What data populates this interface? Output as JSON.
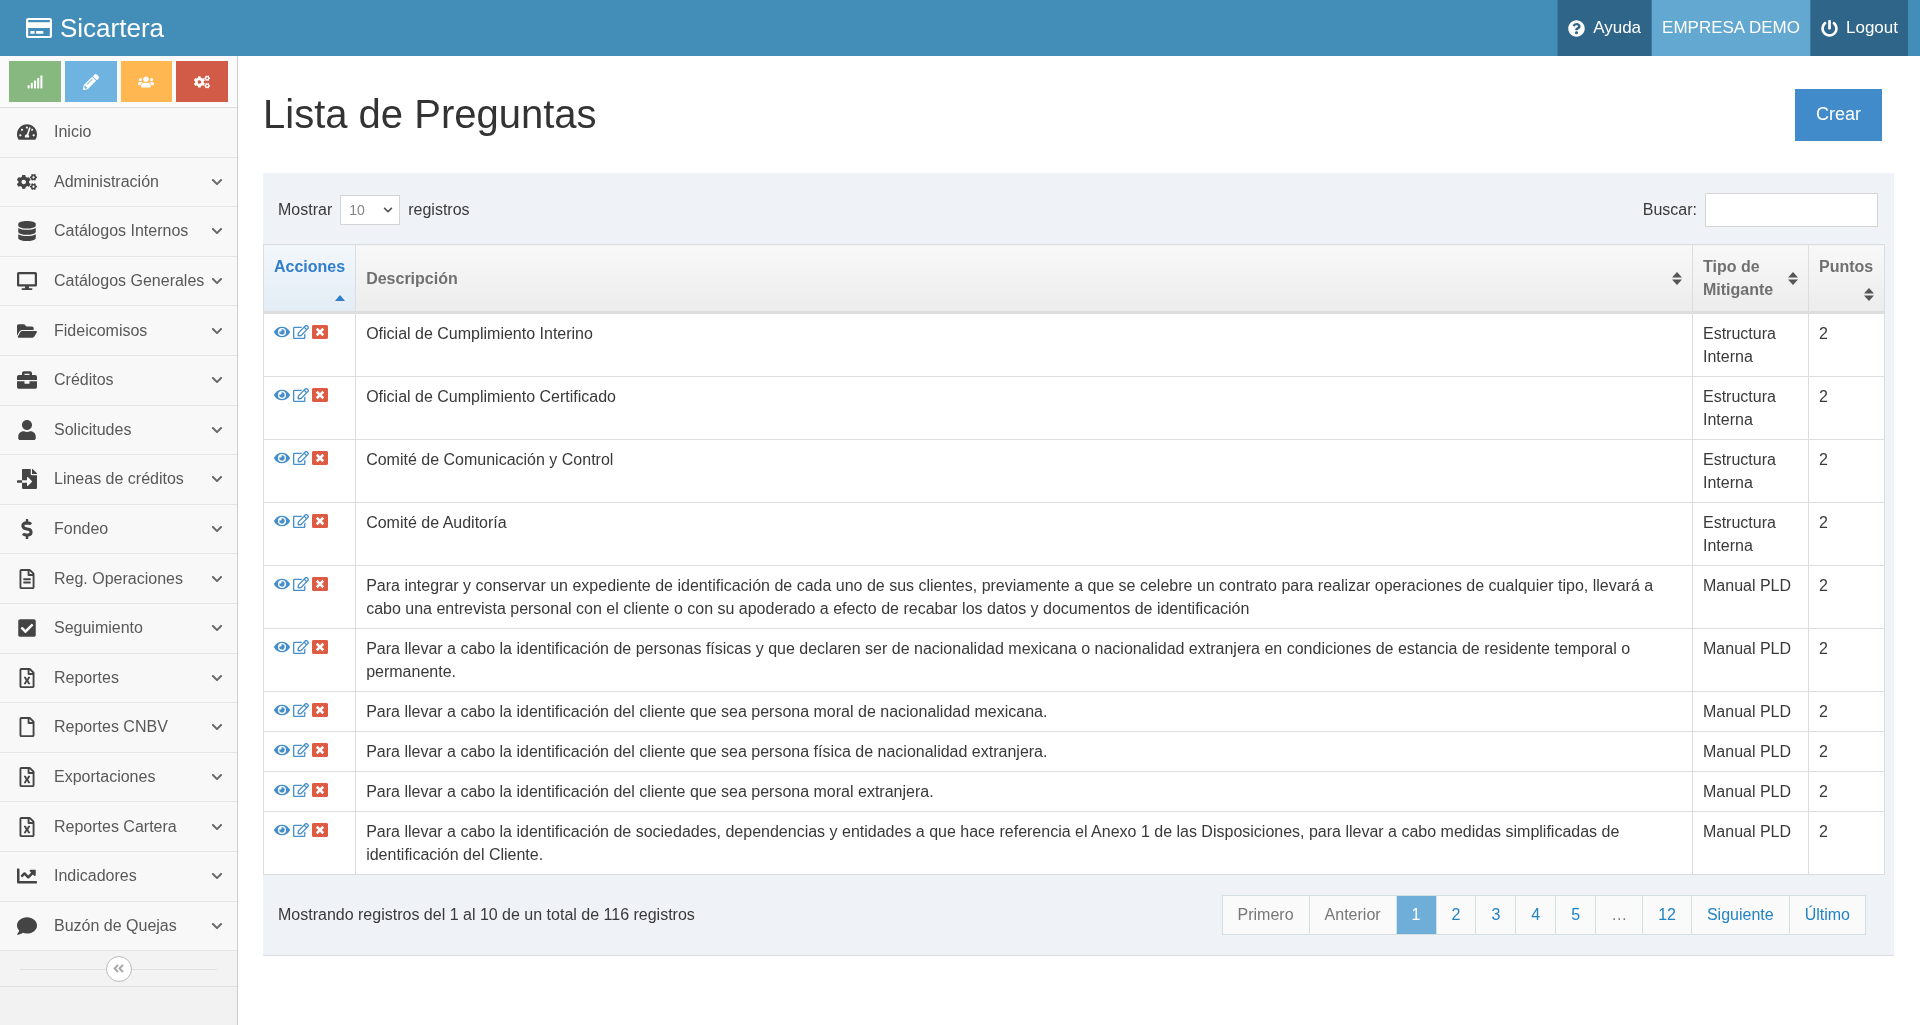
{
  "brand": "Sicartera",
  "topnav": [
    {
      "label": "Ayuda",
      "kind": "help",
      "selected": false
    },
    {
      "label": "EMPRESA DEMO",
      "kind": "company",
      "selected": true
    },
    {
      "label": "Logout",
      "kind": "logout",
      "selected": false
    }
  ],
  "sidebar": {
    "items": [
      {
        "label": "Inicio",
        "submenu": false
      },
      {
        "label": "Administración",
        "submenu": true
      },
      {
        "label": "Catálogos Internos",
        "submenu": true
      },
      {
        "label": "Catálogos Generales",
        "submenu": true
      },
      {
        "label": "Fideicomisos",
        "submenu": true
      },
      {
        "label": "Créditos",
        "submenu": true
      },
      {
        "label": "Solicitudes",
        "submenu": true
      },
      {
        "label": "Lineas de créditos",
        "submenu": true
      },
      {
        "label": "Fondeo",
        "submenu": true
      },
      {
        "label": "Reg. Operaciones",
        "submenu": true
      },
      {
        "label": "Seguimiento",
        "submenu": true
      },
      {
        "label": "Reportes",
        "submenu": true
      },
      {
        "label": "Reportes CNBV",
        "submenu": true
      },
      {
        "label": "Exportaciones",
        "submenu": true
      },
      {
        "label": "Reportes Cartera",
        "submenu": true
      },
      {
        "label": "Indicadores",
        "submenu": true
      },
      {
        "label": "Buzón de Quejas",
        "submenu": true
      }
    ]
  },
  "page_title": "Lista de Preguntas",
  "create_button": "Crear",
  "length_control": {
    "before": "Mostrar",
    "value": "10",
    "after": "registros"
  },
  "search": {
    "label": "Buscar:"
  },
  "table": {
    "columns": [
      {
        "label": "Acciones",
        "sorted": true
      },
      {
        "label": "Descripción",
        "sorted": false
      },
      {
        "label": "Tipo de Mitigante",
        "sorted": false
      },
      {
        "label": "Puntos",
        "sorted": false
      }
    ],
    "rows": [
      {
        "descripcion": "Oficial de Cumplimiento Interino",
        "tipo": "Estructura Interna",
        "puntos": "2"
      },
      {
        "descripcion": "Oficial de Cumplimiento Certificado",
        "tipo": "Estructura Interna",
        "puntos": "2"
      },
      {
        "descripcion": "Comité de Comunicación y Control",
        "tipo": "Estructura Interna",
        "puntos": "2"
      },
      {
        "descripcion": "Comité de Auditoría",
        "tipo": "Estructura Interna",
        "puntos": "2"
      },
      {
        "descripcion": "Para integrar y conservar un expediente de identificación de cada uno de sus clientes, previamente a que se celebre un contrato para realizar operaciones de cualquier tipo, llevará a cabo una entrevista personal con el cliente o con su apoderado a efecto de recabar los datos y documentos de identificación",
        "tipo": "Manual PLD",
        "puntos": "2"
      },
      {
        "descripcion": "Para llevar a cabo la identificación de personas físicas y que declaren ser de nacionalidad mexicana o nacionalidad extranjera en condiciones de estancia de residente temporal o permanente.",
        "tipo": "Manual PLD",
        "puntos": "2"
      },
      {
        "descripcion": "Para llevar a cabo la identificación del cliente que sea persona moral de nacionalidad mexicana.",
        "tipo": "Manual PLD",
        "puntos": "2"
      },
      {
        "descripcion": "Para llevar a cabo la identificación del cliente que sea persona física de nacionalidad extranjera.",
        "tipo": "Manual PLD",
        "puntos": "2"
      },
      {
        "descripcion": "Para llevar a cabo la identificación del cliente que sea persona moral extranjera.",
        "tipo": "Manual PLD",
        "puntos": "2"
      },
      {
        "descripcion": "Para llevar a cabo la identificación de sociedades, dependencias y entidades a que hace referencia el Anexo 1 de las Disposiciones, para llevar a cabo medidas simplificadas de identificación del Cliente.",
        "tipo": "Manual PLD",
        "puntos": "2"
      }
    ]
  },
  "info": "Mostrando registros del 1 al 10 de un total de 116 registros",
  "pagination": [
    {
      "label": "Primero",
      "selected": false,
      "disabled": true
    },
    {
      "label": "Anterior",
      "selected": false,
      "disabled": true
    },
    {
      "label": "1",
      "selected": true,
      "disabled": false
    },
    {
      "label": "2",
      "selected": false,
      "disabled": false
    },
    {
      "label": "3",
      "selected": false,
      "disabled": false
    },
    {
      "label": "4",
      "selected": false,
      "disabled": false
    },
    {
      "label": "5",
      "selected": false,
      "disabled": false
    },
    {
      "label": "…",
      "selected": false,
      "disabled": true
    },
    {
      "label": "12",
      "selected": false,
      "disabled": false
    },
    {
      "label": "Siguiente",
      "selected": false,
      "disabled": false
    },
    {
      "label": "Último",
      "selected": false,
      "disabled": false
    }
  ]
}
